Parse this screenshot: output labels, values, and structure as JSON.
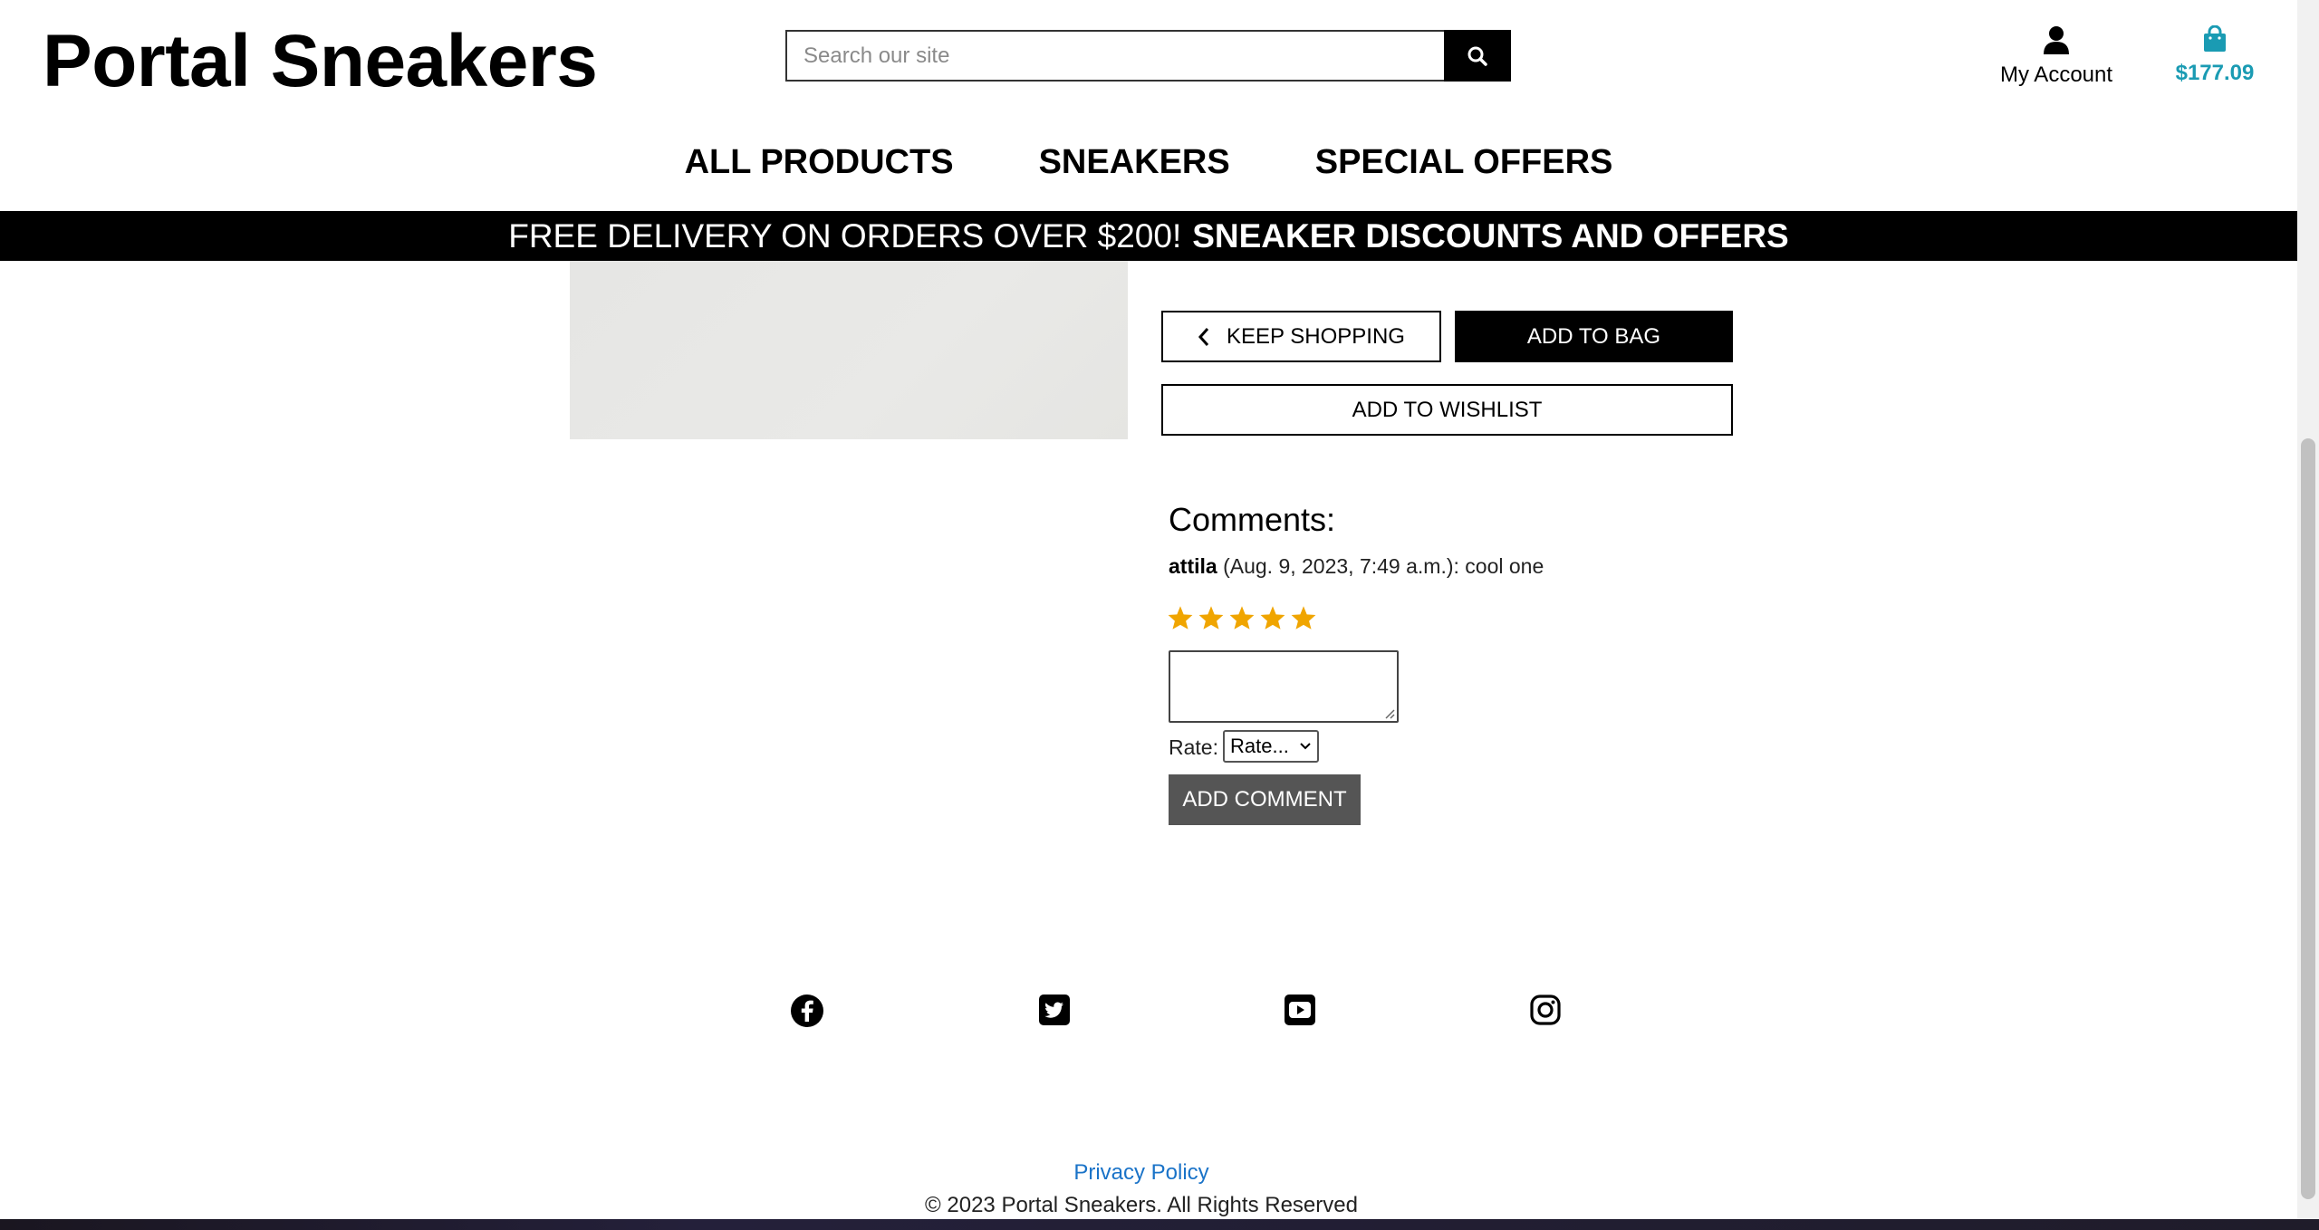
{
  "header": {
    "logo": "Portal Sneakers",
    "search_placeholder": "Search our site",
    "account_label": "My Account",
    "bag_total": "$177.09"
  },
  "nav": {
    "items": [
      "ALL PRODUCTS",
      "SNEAKERS",
      "SPECIAL OFFERS"
    ]
  },
  "banner": {
    "text": "FREE DELIVERY ON ORDERS OVER $200!",
    "highlight": "SNEAKER DISCOUNTS AND OFFERS"
  },
  "product": {
    "keep_shopping": "KEEP SHOPPING",
    "add_to_bag": "ADD TO BAG",
    "add_to_wishlist": "ADD TO WISHLIST"
  },
  "comments": {
    "title": "Comments:",
    "items": [
      {
        "author": "attila",
        "date": "(Aug. 9, 2023, 7:49 a.m.):",
        "text": "cool one"
      }
    ],
    "rating_stars": 5,
    "star_color": "#f0a500",
    "rate_label": "Rate:",
    "rate_selected": "Rate...",
    "add_comment": "ADD COMMENT"
  },
  "footer": {
    "social_icons": [
      "facebook-icon",
      "twitter-icon",
      "youtube-icon",
      "instagram-icon"
    ],
    "privacy": "Privacy Policy",
    "copyright": "© 2023 Portal Sneakers. All Rights Reserved"
  },
  "colors": {
    "accent": "#1a9bb3",
    "link": "#1a73c8"
  }
}
